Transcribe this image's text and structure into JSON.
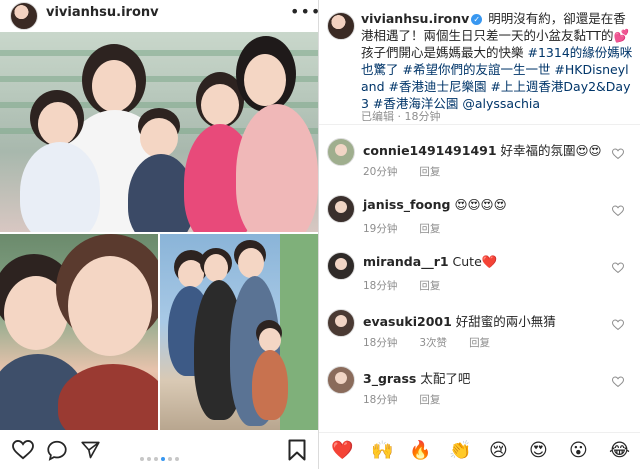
{
  "post": {
    "username": "vivianhsu.ironv",
    "more_icon": "more-horizontal-icon",
    "carousel": {
      "total": 6,
      "active_index": 3
    }
  },
  "actions": {
    "like_icon": "heart-outline-icon",
    "comment_icon": "comment-icon",
    "share_icon": "share-icon",
    "save_icon": "bookmark-icon"
  },
  "caption": {
    "username": "vivianhsu.ironv",
    "text_part1": " 明明沒有約，卻還是在香港相遇了！兩個生日只差一天的小盆友黏TT的",
    "heart": "💕",
    "text_part2": "孩子們開心是媽媽最大的快樂",
    "tags": "#1314的緣份媽咪也驚了 #希望你們的友誼一生一世 #HKDisneyland #香港迪士尼樂園 #上上週香港Day2&Day3 #香港海洋公園 @alyssachia",
    "edited_label": "已编辑",
    "time": "18分钟"
  },
  "comments": [
    {
      "username": "connie1491491491",
      "text": " 好幸福的氛圍",
      "emoji": "😍😍",
      "time": "20分钟",
      "likes": "",
      "reply": "回复"
    },
    {
      "username": "janiss_foong",
      "text": " ",
      "emoji": "😍😍😍😍",
      "time": "19分钟",
      "likes": "",
      "reply": "回复"
    },
    {
      "username": "miranda__r1",
      "text": " Cute",
      "emoji": "❤️",
      "time": "18分钟",
      "likes": "",
      "reply": "回复"
    },
    {
      "username": "evasuki2001",
      "text": " 好甜蜜的兩小無猜",
      "emoji": "",
      "time": "18分钟",
      "likes": "3次赞",
      "reply": "回复"
    },
    {
      "username": "3_grass",
      "text": " 太配了吧",
      "emoji": "",
      "time": "18分钟",
      "likes": "",
      "reply": "回复"
    }
  ],
  "emoji_bar": [
    "❤️",
    "🙌",
    "🔥",
    "👏",
    "😢",
    "😍",
    "😮",
    "😂"
  ]
}
